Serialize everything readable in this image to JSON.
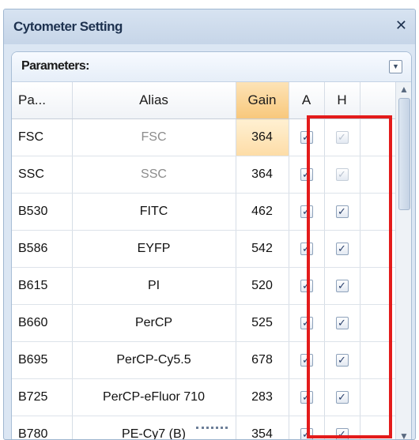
{
  "window": {
    "title": "Cytometer Setting",
    "close_icon": "close-icon"
  },
  "group": {
    "title": "Parameters:",
    "collapse_icon": "collapse-icon"
  },
  "table": {
    "headers": [
      "Pa...",
      "Alias",
      "Gain",
      "A",
      "H"
    ],
    "rows": [
      {
        "param": "FSC",
        "alias": "FSC",
        "gain": "364",
        "a_checked": true,
        "h_checked": true,
        "h_disabled": true,
        "alias_dim": true
      },
      {
        "param": "SSC",
        "alias": "SSC",
        "gain": "364",
        "a_checked": true,
        "h_checked": true,
        "h_disabled": true,
        "alias_dim": true
      },
      {
        "param": "B530",
        "alias": "FITC",
        "gain": "462",
        "a_checked": true,
        "h_checked": true,
        "h_disabled": false,
        "alias_dim": false
      },
      {
        "param": "B586",
        "alias": "EYFP",
        "gain": "542",
        "a_checked": true,
        "h_checked": true,
        "h_disabled": false,
        "alias_dim": false
      },
      {
        "param": "B615",
        "alias": "PI",
        "gain": "520",
        "a_checked": true,
        "h_checked": true,
        "h_disabled": false,
        "alias_dim": false
      },
      {
        "param": "B660",
        "alias": "PerCP",
        "gain": "525",
        "a_checked": true,
        "h_checked": true,
        "h_disabled": false,
        "alias_dim": false
      },
      {
        "param": "B695",
        "alias": "PerCP-Cy5.5",
        "gain": "678",
        "a_checked": true,
        "h_checked": true,
        "h_disabled": false,
        "alias_dim": false
      },
      {
        "param": "B725",
        "alias": "PerCP-eFluor 710",
        "gain": "283",
        "a_checked": true,
        "h_checked": true,
        "h_disabled": false,
        "alias_dim": false
      },
      {
        "param": "B780",
        "alias": "PE-Cy7 (B)",
        "gain": "354",
        "a_checked": true,
        "h_checked": true,
        "h_disabled": false,
        "alias_dim": false
      }
    ]
  },
  "colors": {
    "highlight": "#e31b1b",
    "gain_header": "#f8c87c"
  }
}
